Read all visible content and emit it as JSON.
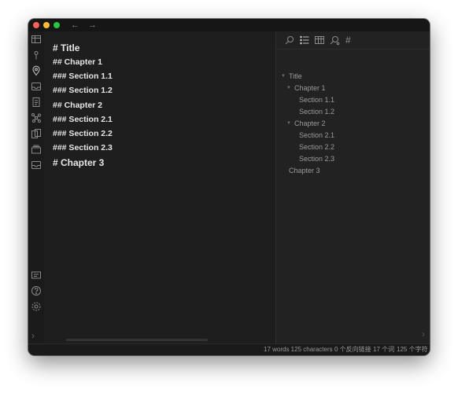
{
  "window": {
    "nav": {
      "back": "←",
      "forward": "→"
    }
  },
  "ribbon": {
    "icons": [
      "table-icon",
      "pin-icon",
      "location-icon",
      "inbox-icon",
      "document-icon",
      "graph-icon",
      "copy-icon",
      "layers-icon",
      "archive-icon"
    ],
    "bottom_icons": [
      "card-icon",
      "help-icon",
      "settings-icon"
    ]
  },
  "editor": {
    "lines": [
      "# Title",
      "## Chapter 1",
      "### Section 1.1",
      "### Section 1.2",
      "## Chapter 2",
      "### Section 2.1",
      "### Section 2.2",
      "### Section 2.3",
      "# Chapter 3"
    ]
  },
  "right_panel": {
    "toolbar_icons": [
      "search-icon",
      "outline-list-icon",
      "table-icon",
      "search-settings-icon",
      "hashtag-icon"
    ],
    "hash_glyph": "#",
    "outline": [
      {
        "label": "Title",
        "level": 0,
        "collapsible": true
      },
      {
        "label": "Chapter 1",
        "level": 1,
        "collapsible": true
      },
      {
        "label": "Section 1.1",
        "level": 2,
        "collapsible": false
      },
      {
        "label": "Section 1.2",
        "level": 2,
        "collapsible": false
      },
      {
        "label": "Chapter 2",
        "level": 1,
        "collapsible": true
      },
      {
        "label": "Section 2.1",
        "level": 2,
        "collapsible": false
      },
      {
        "label": "Section 2.2",
        "level": 2,
        "collapsible": false
      },
      {
        "label": "Section 2.3",
        "level": 2,
        "collapsible": false
      },
      {
        "label": "Chapter 3",
        "level": 0,
        "collapsible": false
      }
    ]
  },
  "status": {
    "word_count": "17 words 125 characters",
    "backlinks": "0 个反向链接",
    "words_cn": "17 个词",
    "chars_cn": "125 个字符"
  }
}
